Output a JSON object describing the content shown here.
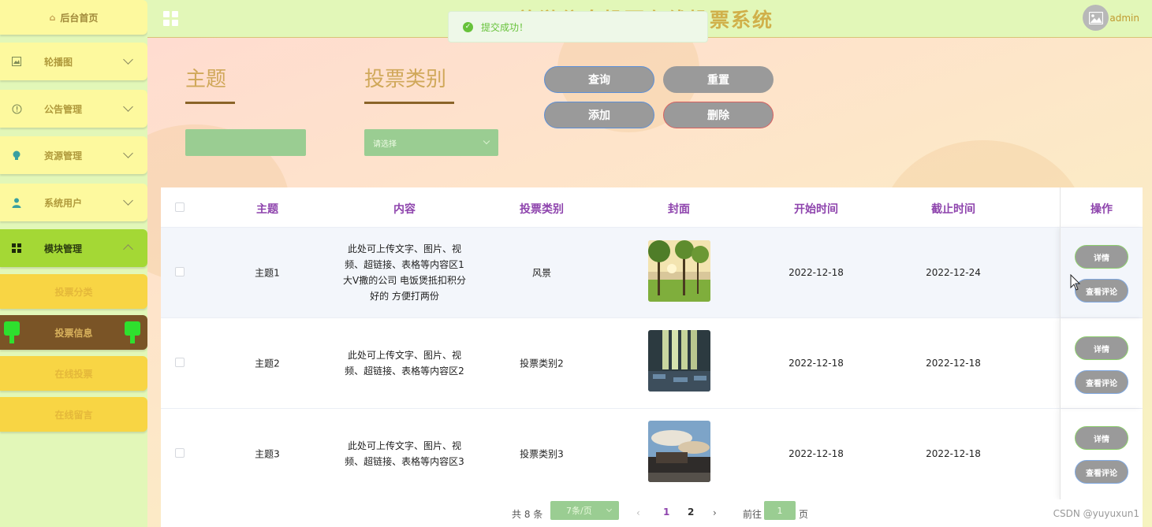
{
  "header": {
    "title": "旅游信息投票在线投票系统",
    "username": "admin"
  },
  "toast": {
    "message": "提交成功！"
  },
  "sidebar": {
    "home": "后台首页",
    "menus": [
      {
        "label": "轮播图",
        "icon": "image-icon"
      },
      {
        "label": "公告管理",
        "icon": "alert-icon"
      },
      {
        "label": "资源管理",
        "icon": "bulb-icon"
      },
      {
        "label": "系统用户",
        "icon": "user-icon"
      },
      {
        "label": "模块管理",
        "icon": "grid-icon"
      }
    ],
    "submenu": [
      "投票分类",
      "投票信息",
      "在线投票",
      "在线留言"
    ]
  },
  "search": {
    "subject_label": "主题",
    "category_label": "投票类别",
    "category_placeholder": "请选择",
    "buttons": {
      "query": "查询",
      "reset": "重置",
      "add": "添加",
      "delete": "删除"
    }
  },
  "table": {
    "headers": [
      "主题",
      "内容",
      "投票类别",
      "封面",
      "开始时间",
      "截止时间",
      "操作"
    ],
    "rows": [
      {
        "subject": "主题1",
        "content": "此处可上传文字、图片、视频、超链接、表格等内容区1 大V撒的公司 电饭煲抵扣积分好的 方便打两份",
        "category": "风景",
        "start": "2022-12-18",
        "end": "2022-12-24"
      },
      {
        "subject": "主题2",
        "content": "此处可上传文字、图片、视频、超链接、表格等内容区2",
        "category": "投票类别2",
        "start": "2022-12-18",
        "end": "2022-12-18"
      },
      {
        "subject": "主题3",
        "content": "此处可上传文字、图片、视频、超链接、表格等内容区3",
        "category": "投票类别3",
        "start": "2022-12-18",
        "end": "2022-12-18"
      }
    ],
    "op_detail": "详情",
    "op_comments": "查看评论"
  },
  "pager": {
    "total": "共 8 条",
    "page_size": "7条/页",
    "pages": [
      "1",
      "2"
    ],
    "goto_prefix": "前往",
    "goto_value": "1",
    "goto_suffix": "页"
  },
  "watermark": "CSDN @yuyuxun1"
}
